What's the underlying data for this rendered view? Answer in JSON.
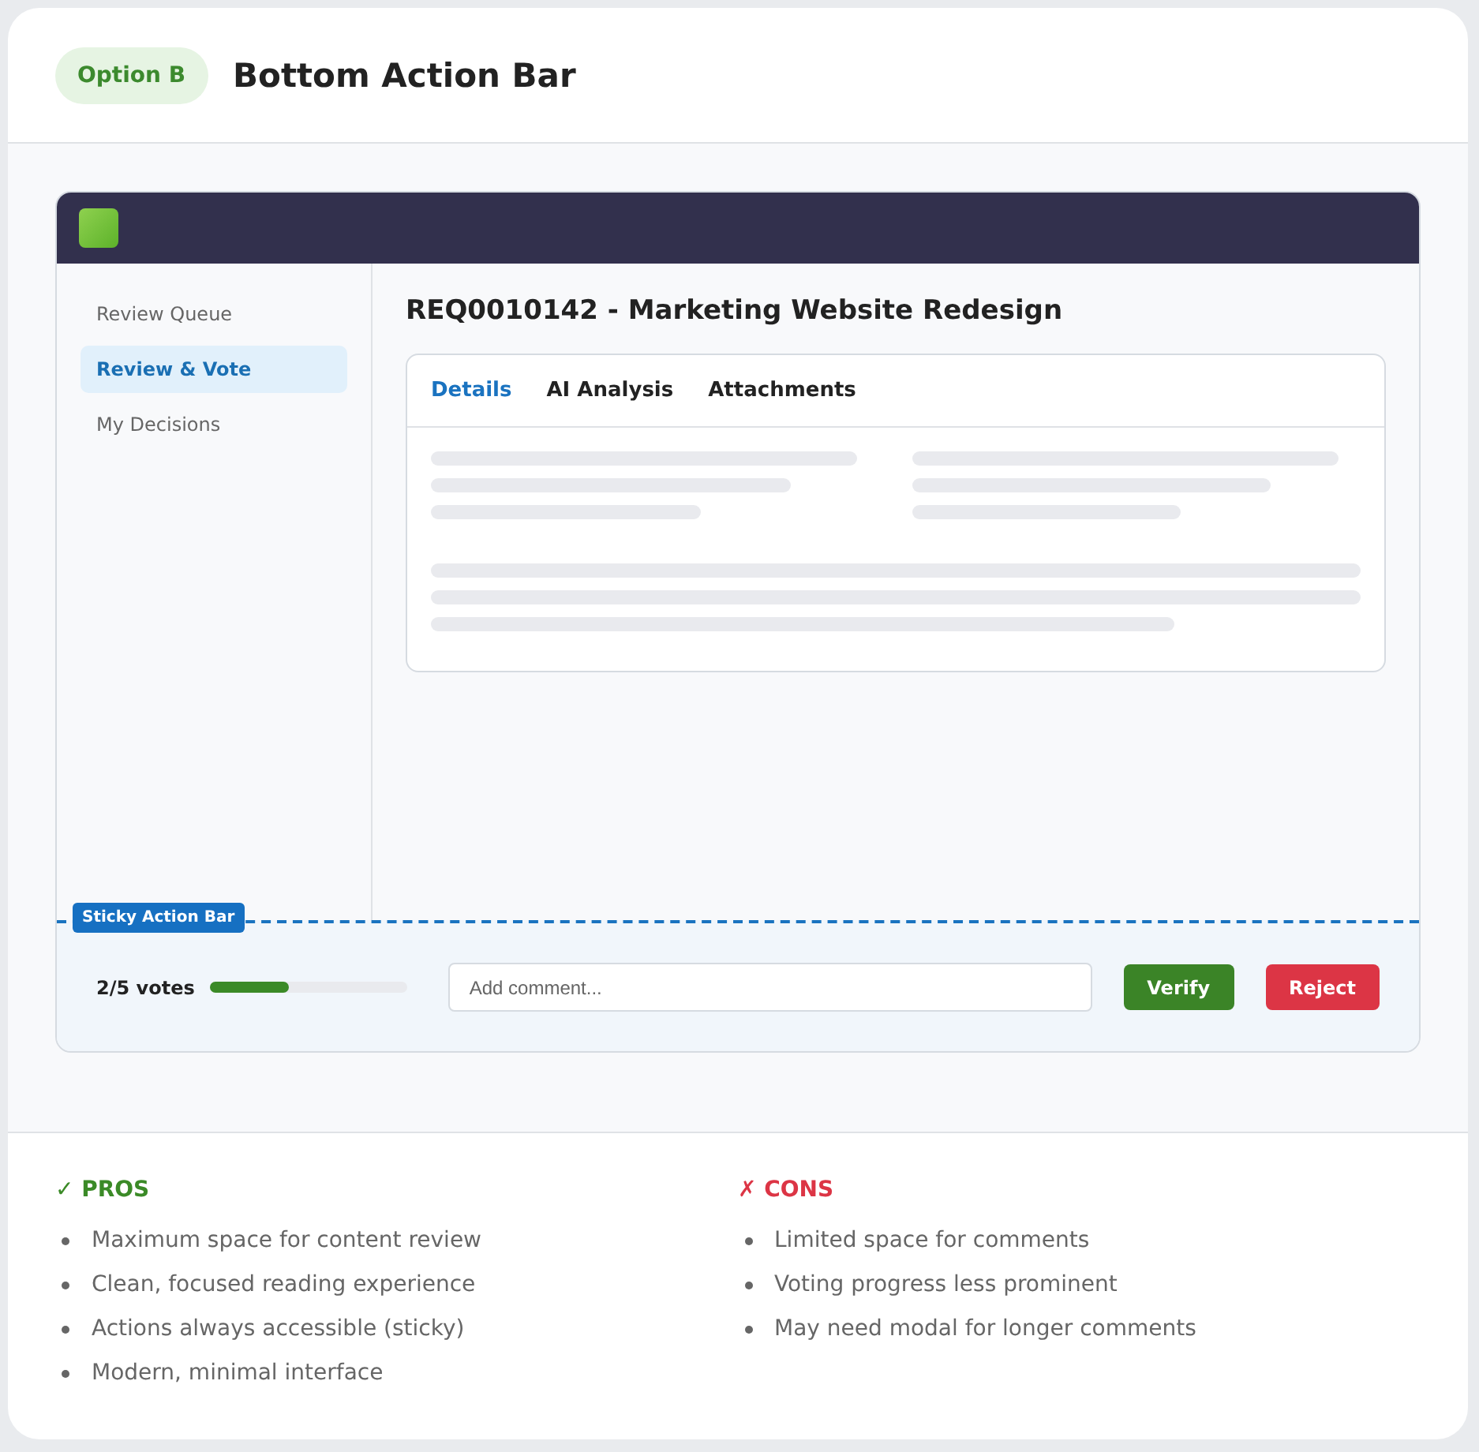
{
  "header": {
    "badge": "Option B",
    "title": "Bottom Action Bar"
  },
  "app": {
    "sidebar": {
      "items": [
        {
          "label": "Review Queue",
          "selected": false
        },
        {
          "label": "Review & Vote",
          "selected": true
        },
        {
          "label": "My Decisions",
          "selected": false
        }
      ]
    },
    "request_title": "REQ0010142 - Marketing Website Redesign",
    "tabs": [
      {
        "label": "Details",
        "selected": true
      },
      {
        "label": "AI Analysis",
        "selected": false
      },
      {
        "label": "Attachments",
        "selected": false
      }
    ],
    "action_bar": {
      "label": "Sticky Action Bar",
      "votes": "2/5 votes",
      "vote_progress": {
        "level": 0.4
      },
      "comment": {
        "placeholder": "Add comment..."
      },
      "buttons": [
        {
          "label": "Verify",
          "kind": "verify"
        },
        {
          "label": "Reject",
          "kind": "reject"
        }
      ]
    }
  },
  "pros": {
    "heading": "✓ PROS",
    "items": [
      "Maximum space for content review",
      "Clean, focused reading experience",
      "Actions always accessible (sticky)",
      "Modern, minimal interface"
    ]
  },
  "cons": {
    "heading": "✗ CONS",
    "items": [
      "Limited space for comments",
      "Voting progress less prominent",
      "May need modal for longer comments"
    ]
  }
}
